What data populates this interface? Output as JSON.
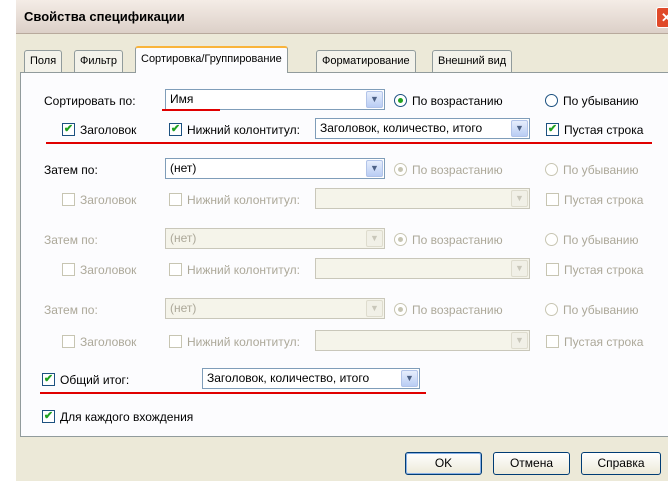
{
  "window": {
    "title": "Свойства спецификации",
    "close_label": "✕"
  },
  "tabs": [
    {
      "label": "Поля",
      "active": false
    },
    {
      "label": "Фильтр",
      "active": false
    },
    {
      "label": "Сортировка/Группирование",
      "active": true
    },
    {
      "label": "Форматирование",
      "active": false
    },
    {
      "label": "Внешний вид",
      "active": false
    }
  ],
  "sort": {
    "label": "Сортировать по:",
    "field": "Имя",
    "asc_label": "По возрастанию",
    "desc_label": "По убыванию",
    "order": "ascending",
    "header_label": "Заголовок",
    "header_checked": true,
    "footer_label": "Нижний колонтитул:",
    "footer_checked": true,
    "footer_value": "Заголовок, количество, итого",
    "blank_label": "Пустая строка",
    "blank_checked": true
  },
  "then_by": [
    {
      "label": "Затем по:",
      "field": "(нет)",
      "enabled": true
    },
    {
      "label": "Затем по:",
      "field": "(нет)",
      "enabled": false
    },
    {
      "label": "Затем по:",
      "field": "(нет)",
      "enabled": false
    }
  ],
  "then_labels": {
    "asc_label": "По возрастанию",
    "desc_label": "По убыванию",
    "header_label": "Заголовок",
    "footer_label": "Нижний колонтитул:",
    "blank_label": "Пустая строка"
  },
  "grand_total": {
    "label": "Общий итог:",
    "checked": true,
    "value": "Заголовок, количество, итого"
  },
  "each_instance": {
    "label": "Для каждого вхождения",
    "checked": true
  },
  "buttons": {
    "ok": "OK",
    "cancel": "Отмена",
    "help": "Справка"
  },
  "colors": {
    "accent": "#21a121",
    "annotation": "#e00000",
    "tab_highlight": "#f9b43b"
  },
  "icons": {
    "checkbox": "check-icon",
    "combo": "chevron-down-icon"
  }
}
